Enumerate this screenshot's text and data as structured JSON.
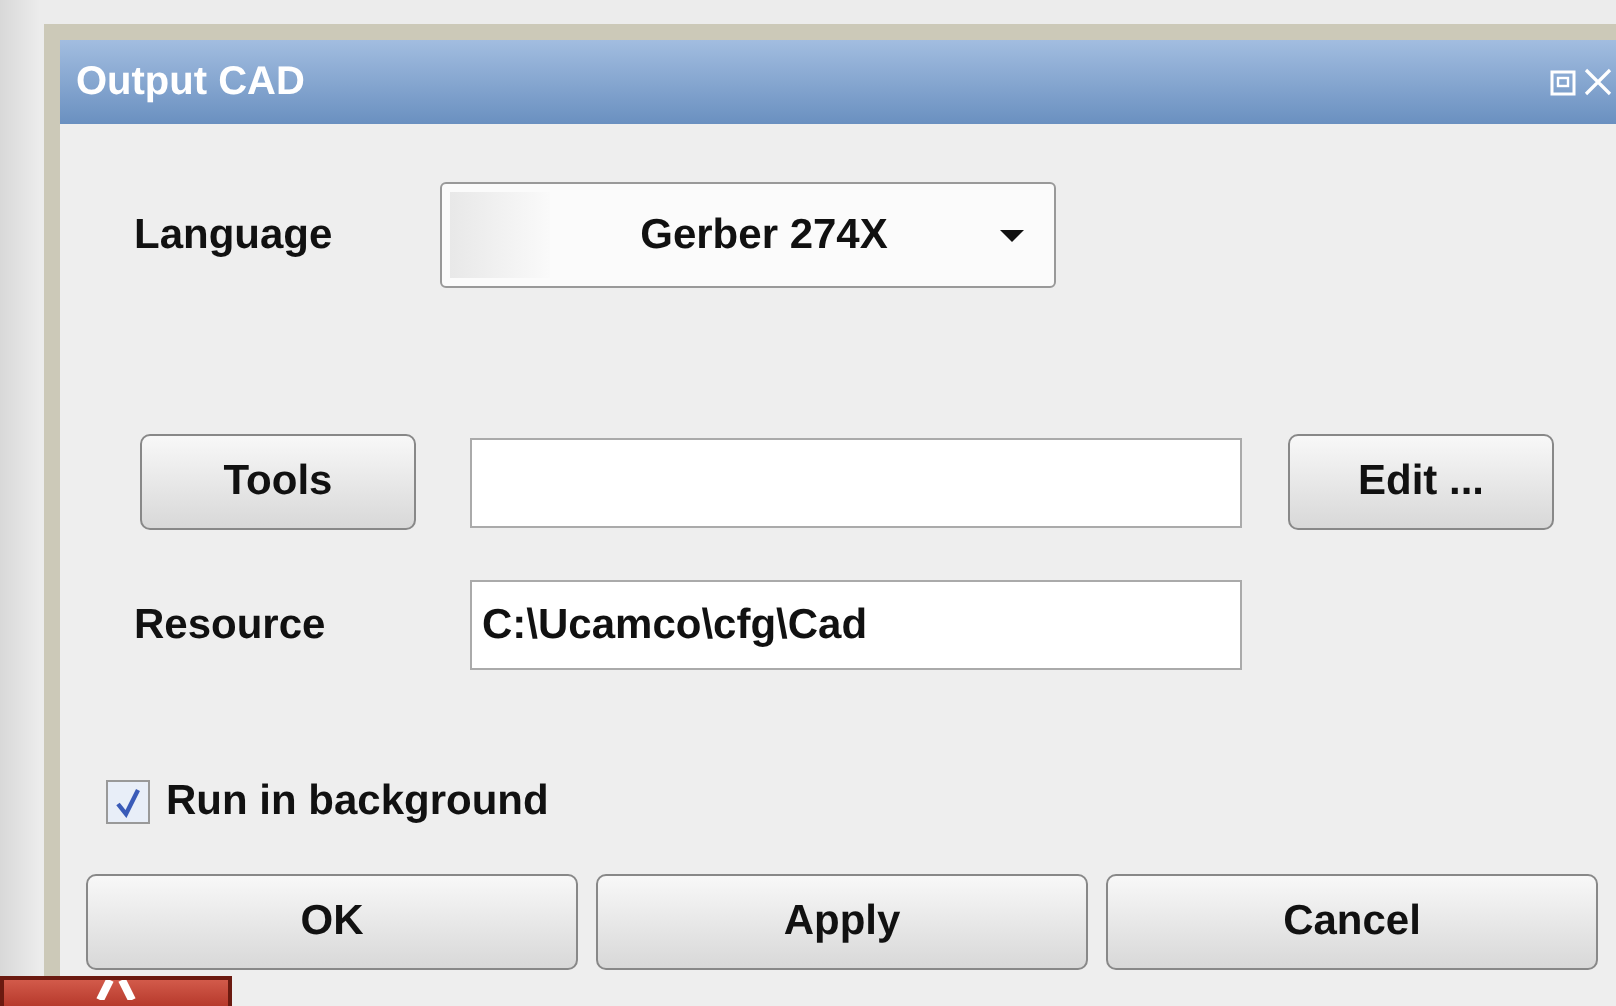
{
  "window": {
    "title": "Output CAD"
  },
  "language": {
    "label": "Language",
    "value": "Gerber 274X"
  },
  "tools": {
    "button": "Tools"
  },
  "edit_button": "Edit ...",
  "resource": {
    "label": "Resource",
    "value": "C:\\Ucamco\\cfg\\Cad"
  },
  "run_in_background": {
    "label": "Run in background",
    "checked": true
  },
  "buttons": [
    "OK",
    "Apply",
    "Cancel"
  ]
}
